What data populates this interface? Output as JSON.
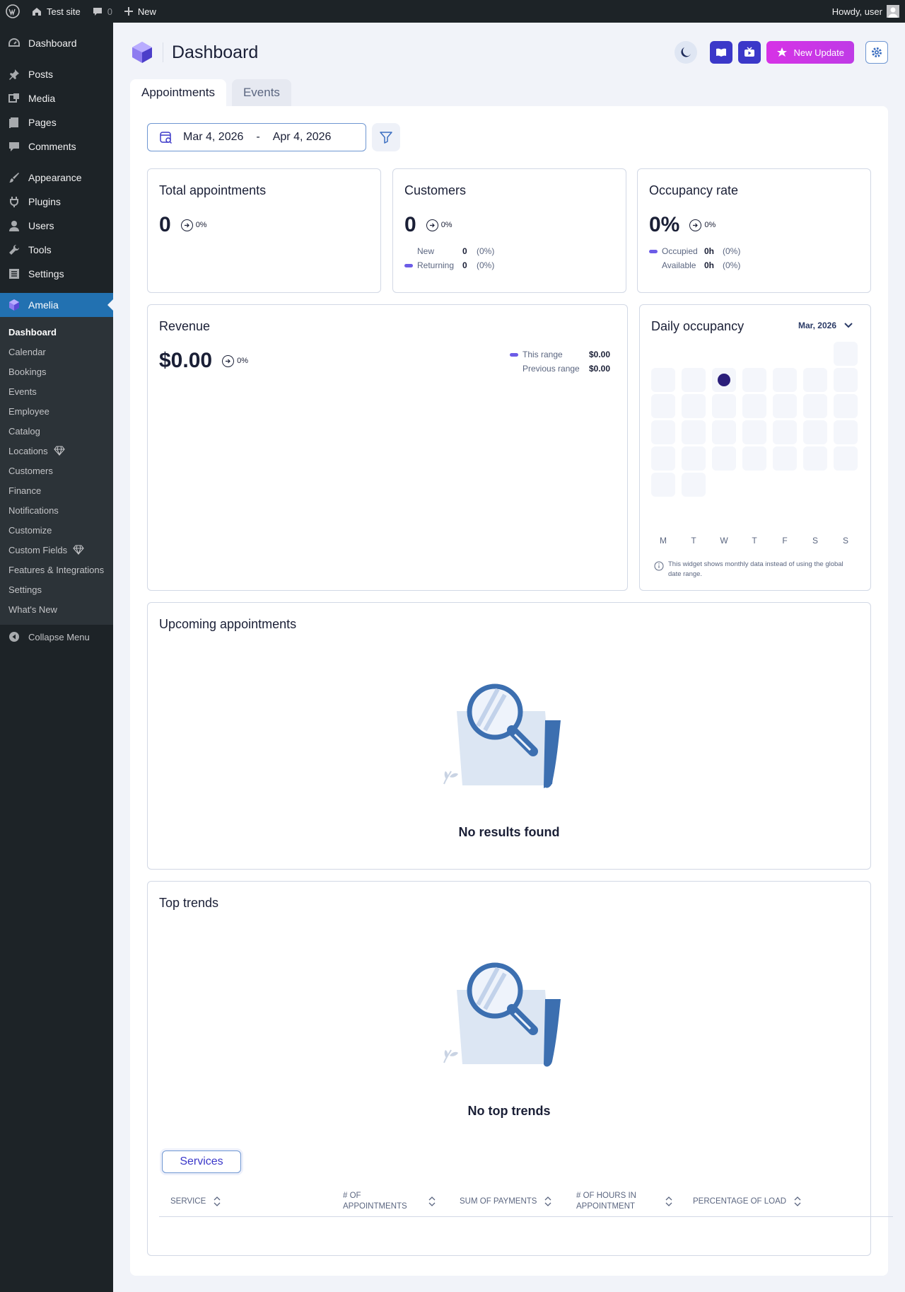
{
  "adminbar": {
    "site": "Test site",
    "comments": "0",
    "new": "New",
    "howdy": "Howdy, user"
  },
  "sidebar": {
    "items": [
      {
        "label": "Dashboard",
        "icon": "dashboard-icon"
      },
      {
        "label": "Posts",
        "icon": "pin-icon"
      },
      {
        "label": "Media",
        "icon": "media-icon"
      },
      {
        "label": "Pages",
        "icon": "pages-icon"
      },
      {
        "label": "Comments",
        "icon": "comment-icon"
      },
      {
        "label": "Appearance",
        "icon": "brush-icon"
      },
      {
        "label": "Plugins",
        "icon": "plugin-icon"
      },
      {
        "label": "Users",
        "icon": "user-icon"
      },
      {
        "label": "Tools",
        "icon": "wrench-icon"
      },
      {
        "label": "Settings",
        "icon": "settings-icon"
      },
      {
        "label": "Amelia",
        "icon": "amelia-icon"
      }
    ],
    "sub": [
      "Dashboard",
      "Calendar",
      "Bookings",
      "Events",
      "Employee",
      "Catalog",
      "Locations",
      "Customers",
      "Finance",
      "Notifications",
      "Customize",
      "Custom Fields",
      "Features & Integrations",
      "Settings",
      "What's New"
    ],
    "collapse": "Collapse Menu"
  },
  "header": {
    "title": "Dashboard",
    "new_update": "New Update"
  },
  "tabs": [
    "Appointments",
    "Events"
  ],
  "daterange": {
    "from": "Mar 4, 2026",
    "sep": "-",
    "to": "Apr 4, 2026"
  },
  "cards": {
    "total": {
      "title": "Total appointments",
      "value": "0",
      "change": "0%"
    },
    "customers": {
      "title": "Customers",
      "value": "0",
      "change": "0%",
      "rows": [
        {
          "label": "New",
          "value": "0",
          "pct": "(0%)"
        },
        {
          "label": "Returning",
          "value": "0",
          "pct": "(0%)"
        }
      ]
    },
    "occupancy": {
      "title": "Occupancy rate",
      "value": "0%",
      "change": "0%",
      "rows": [
        {
          "label": "Occupied",
          "value": "0h",
          "pct": "(0%)"
        },
        {
          "label": "Available",
          "value": "0h",
          "pct": "(0%)"
        }
      ]
    },
    "revenue": {
      "title": "Revenue",
      "value": "$0.00",
      "change": "0%",
      "rows": [
        {
          "label": "This range",
          "value": "$0.00"
        },
        {
          "label": "Previous range",
          "value": "$0.00"
        }
      ]
    },
    "daily": {
      "title": "Daily occupancy",
      "month": "Mar, 2026",
      "days": [
        "M",
        "T",
        "W",
        "T",
        "F",
        "S",
        "S"
      ],
      "note": "This widget shows monthly data instead of using the global date range."
    }
  },
  "upcoming": {
    "title": "Upcoming appointments",
    "empty": "No results found"
  },
  "trends": {
    "title": "Top trends",
    "empty": "No top trends",
    "tab": "Services",
    "columns": [
      "Service",
      "# of appointments",
      "Sum of payments",
      "# of hours in appointment",
      "Percentage of load"
    ]
  },
  "colors": {
    "primary": "#3b38c9",
    "accent": "#6c5ce7",
    "wp_blue": "#2271b1",
    "wp_dark": "#1d2327"
  }
}
